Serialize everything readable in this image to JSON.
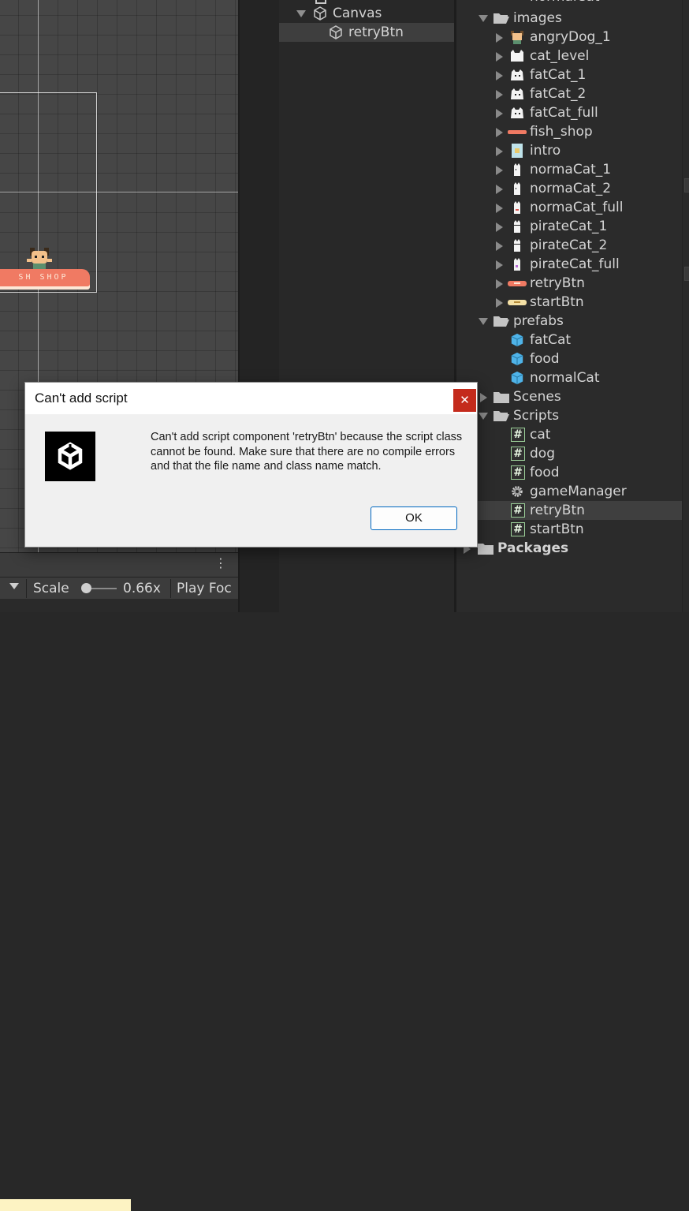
{
  "scene": {
    "sprite_banner_text": "SH SHOP",
    "toolbar": {
      "scale_label": "Scale",
      "scale_value": "0.66x",
      "play_focus": "Play Foc"
    }
  },
  "hierarchy": {
    "items": [
      {
        "label": "Canvas",
        "expanded": true,
        "icon": "cube-icon"
      },
      {
        "label": "retryBtn",
        "selected": true,
        "icon": "cube-icon"
      }
    ]
  },
  "project": {
    "top_partial": "normalCat",
    "images_folder": "images",
    "images": [
      {
        "label": "angryDog_1",
        "icon": "sprite-dog-icon"
      },
      {
        "label": "cat_level",
        "icon": "sprite-cat-icon"
      },
      {
        "label": "fatCat_1",
        "icon": "sprite-fatcat-icon"
      },
      {
        "label": "fatCat_2",
        "icon": "sprite-fatcat-icon"
      },
      {
        "label": "fatCat_full",
        "icon": "sprite-fatcat-icon"
      },
      {
        "label": "fish_shop",
        "icon": "sprite-banner-icon"
      },
      {
        "label": "intro",
        "icon": "sprite-intro-icon"
      },
      {
        "label": "normaCat_1",
        "icon": "sprite-cat-small-icon"
      },
      {
        "label": "normaCat_2",
        "icon": "sprite-cat-small-icon"
      },
      {
        "label": "normaCat_full",
        "icon": "sprite-cat-small-icon"
      },
      {
        "label": "pirateCat_1",
        "icon": "sprite-cat-small-icon"
      },
      {
        "label": "pirateCat_2",
        "icon": "sprite-cat-small-icon"
      },
      {
        "label": "pirateCat_full",
        "icon": "sprite-cat-small-icon"
      },
      {
        "label": "retryBtn",
        "icon": "sprite-banner-icon"
      },
      {
        "label": "startBtn",
        "icon": "sprite-button-icon"
      }
    ],
    "prefabs_folder": "prefabs",
    "prefabs": [
      {
        "label": "fatCat",
        "icon": "prefab-icon"
      },
      {
        "label": "food",
        "icon": "prefab-icon"
      },
      {
        "label": "normalCat",
        "icon": "prefab-icon"
      }
    ],
    "scenes_folder": "Scenes",
    "scripts_folder": "Scripts",
    "scripts": [
      {
        "label": "cat",
        "icon": "csharp-script-icon"
      },
      {
        "label": "dog",
        "icon": "csharp-script-icon"
      },
      {
        "label": "food",
        "icon": "csharp-script-icon"
      },
      {
        "label": "gameManager",
        "icon": "gear-icon"
      },
      {
        "label": "retryBtn",
        "icon": "csharp-script-icon",
        "selected": true
      },
      {
        "label": "startBtn",
        "icon": "csharp-script-icon"
      }
    ],
    "packages_folder": "Packages"
  },
  "dialog": {
    "title": "Can't add script",
    "close_glyph": "✕",
    "message": "Can't add script component 'retryBtn' because the script class cannot be found. Make sure that there are no compile errors and that the file name and class name match.",
    "ok_label": "OK",
    "logo_icon": "unity-logo-icon"
  },
  "colors": {
    "dialog_close": "#c42b1c",
    "ok_border": "#0067c0",
    "prefab_blue": "#4fb3e8",
    "script_green": "#9dd19a",
    "banner": "#f07a63"
  }
}
